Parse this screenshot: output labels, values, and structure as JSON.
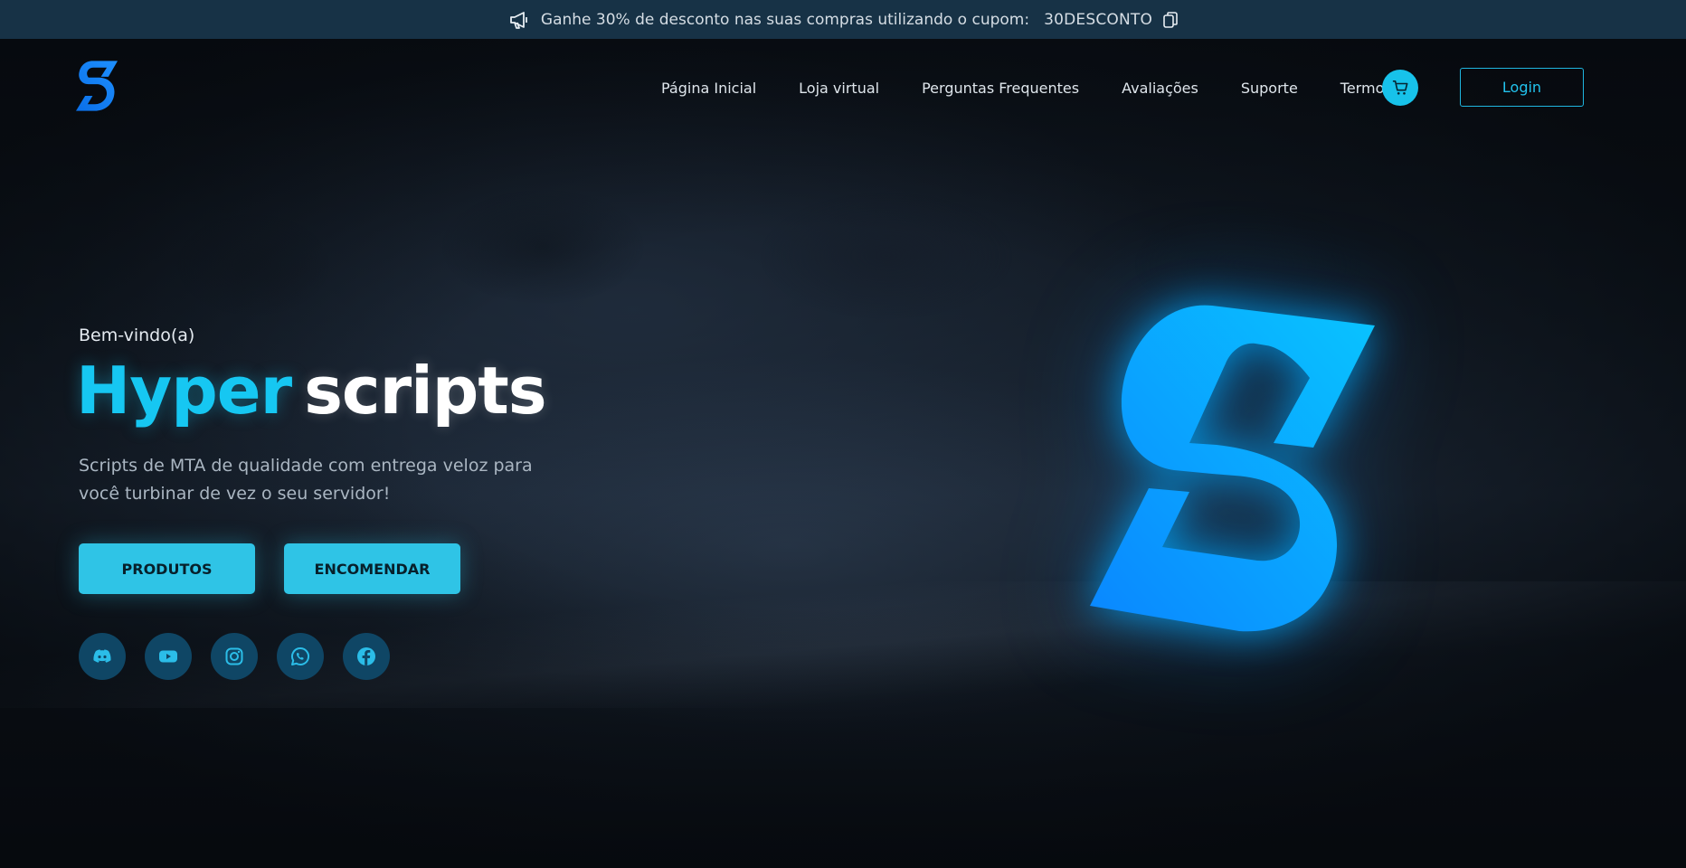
{
  "announcement": {
    "text": "Ganhe 30% de desconto nas suas compras utilizando o cupom:",
    "coupon": "30DESCONTO",
    "icon": "megaphone-icon",
    "copy_icon": "copy-icon"
  },
  "nav": {
    "logo_icon": "hyper-scripts-logo",
    "links": [
      "Página Inicial",
      "Loja virtual",
      "Perguntas Frequentes",
      "Avaliações",
      "Suporte",
      "Termos"
    ],
    "cart_icon": "cart-icon",
    "login_label": "Login"
  },
  "hero": {
    "welcome": "Bem-vindo(a)",
    "title_part1": "Hyper",
    "title_part2": "scripts",
    "subtitle_line1": "Scripts de MTA de qualidade com entrega veloz para",
    "subtitle_line2": "você turbinar de vez o seu servidor!",
    "btn_products": "PRODUTOS",
    "btn_order": "ENCOMENDAR",
    "socials": [
      "discord-icon",
      "youtube-icon",
      "instagram-icon",
      "whatsapp-icon",
      "facebook-icon"
    ]
  },
  "colors": {
    "accent": "#16c7f2",
    "topbar_bg": "#173246",
    "button_bg": "#2fc4e6",
    "social_bg": "#0f4665"
  }
}
